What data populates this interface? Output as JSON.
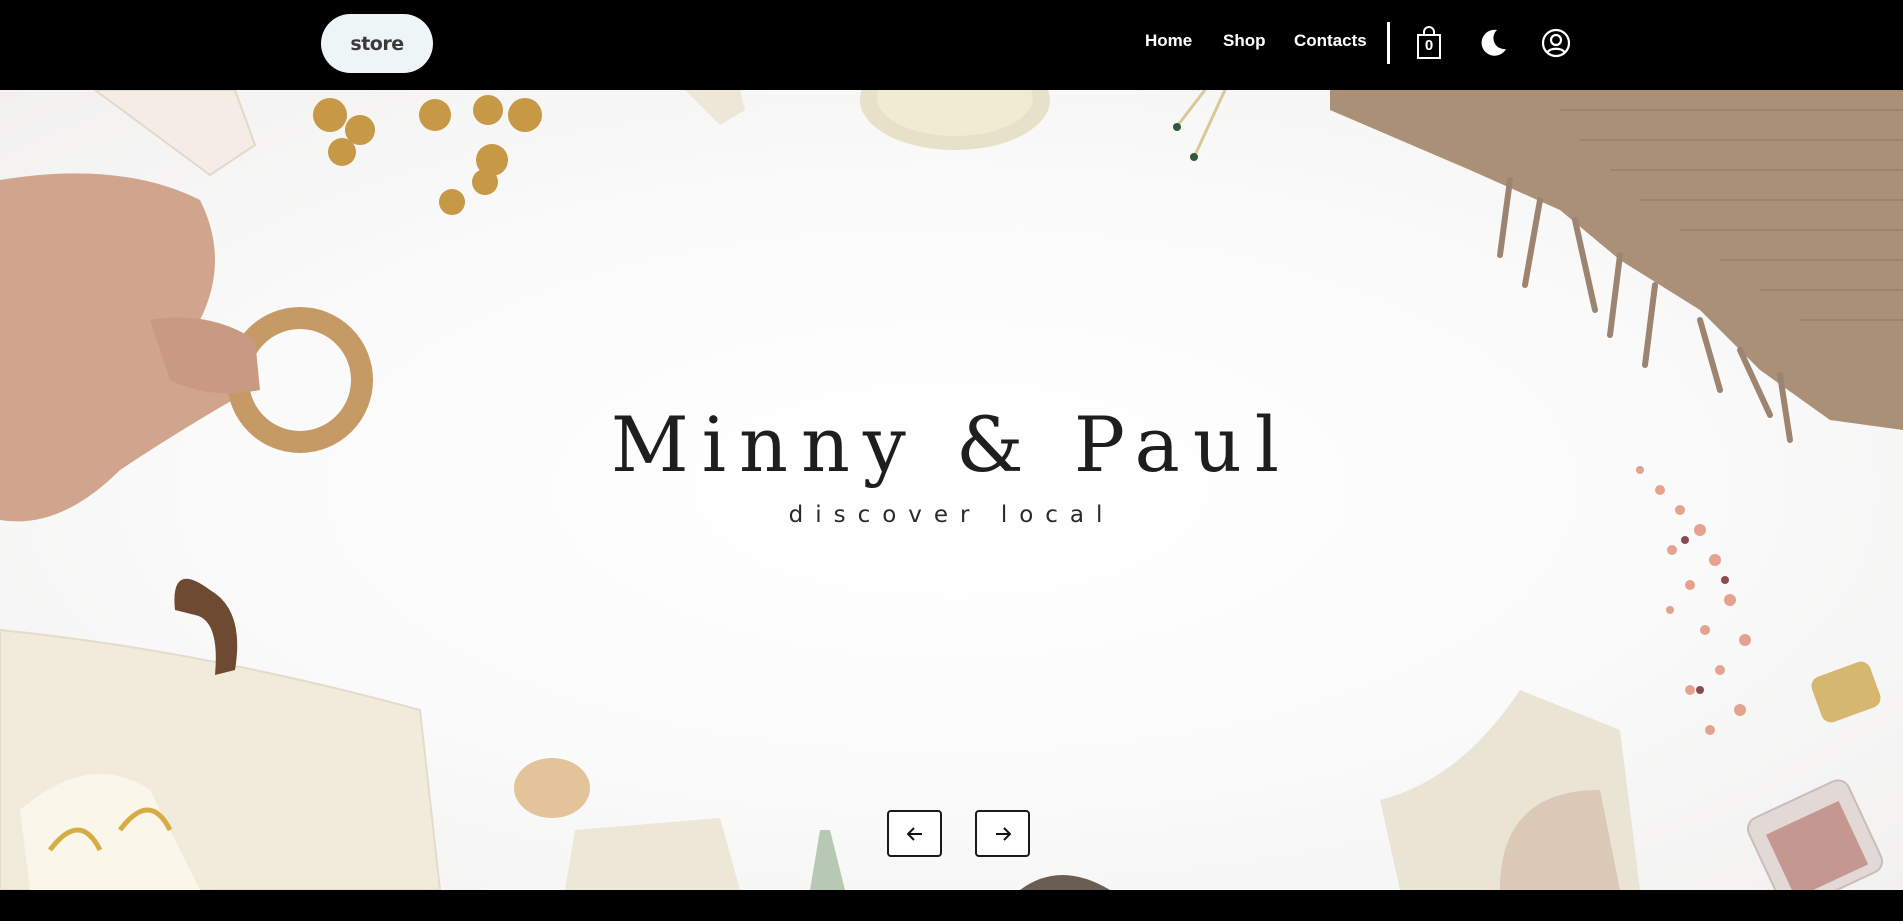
{
  "header": {
    "logo_text": "store",
    "nav": [
      {
        "label": "Home"
      },
      {
        "label": "Shop"
      },
      {
        "label": "Contacts"
      }
    ],
    "cart_count": "0",
    "icons": {
      "cart": "shopping-bag-icon",
      "theme": "moon-icon",
      "account": "user-circle-icon"
    }
  },
  "hero": {
    "title": "Minny & Paul",
    "subtitle": "discover local",
    "controls": {
      "prev_icon": "arrow-left-icon",
      "next_icon": "arrow-right-icon"
    }
  },
  "colors": {
    "nav_background": "#000000",
    "logo_background": "#eef5f7",
    "hero_background": "#fbfbfb",
    "text": "#1e1e1e"
  }
}
